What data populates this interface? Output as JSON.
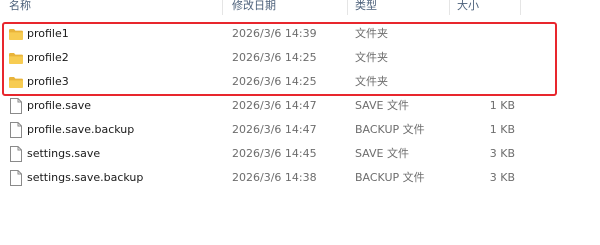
{
  "columns": {
    "name": "名称",
    "date": "修改日期",
    "type": "类型",
    "size": "大小"
  },
  "files": [
    {
      "name": "profile1",
      "date": "2026/3/6 14:39",
      "type": "文件夹",
      "size": "",
      "icon": "folder-icon"
    },
    {
      "name": "profile2",
      "date": "2026/3/6 14:25",
      "type": "文件夹",
      "size": "",
      "icon": "folder-icon"
    },
    {
      "name": "profile3",
      "date": "2026/3/6 14:25",
      "type": "文件夹",
      "size": "",
      "icon": "folder-icon"
    },
    {
      "name": "profile.save",
      "date": "2026/3/6 14:47",
      "type": "SAVE 文件",
      "size": "1 KB",
      "icon": "file-icon"
    },
    {
      "name": "profile.save.backup",
      "date": "2026/3/6 14:47",
      "type": "BACKUP 文件",
      "size": "1 KB",
      "icon": "file-icon"
    },
    {
      "name": "settings.save",
      "date": "2026/3/6 14:45",
      "type": "SAVE 文件",
      "size": "3 KB",
      "icon": "file-icon"
    },
    {
      "name": "settings.save.backup",
      "date": "2026/3/6 14:38",
      "type": "BACKUP 文件",
      "size": "3 KB",
      "icon": "file-icon"
    }
  ],
  "colors": {
    "highlight": "#e8262d",
    "folder": "#f5c542",
    "header_text": "#4c607a"
  }
}
